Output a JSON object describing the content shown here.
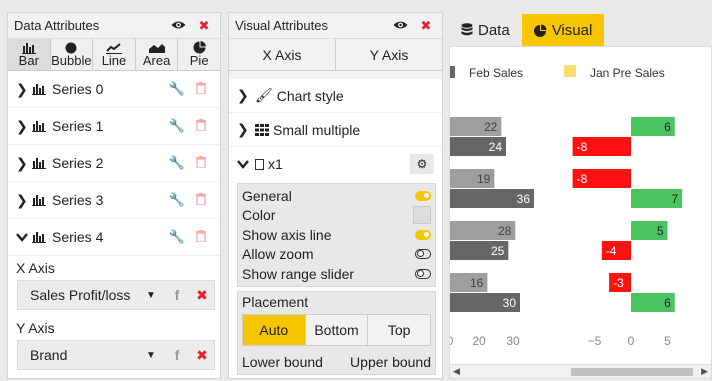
{
  "data_panel": {
    "title": "Data Attributes",
    "chart_types": [
      {
        "label": "Bar",
        "icon": "bar-chart-icon"
      },
      {
        "label": "Bubble",
        "icon": "bubble-icon"
      },
      {
        "label": "Line",
        "icon": "line-chart-icon"
      },
      {
        "label": "Area",
        "icon": "area-chart-icon"
      },
      {
        "label": "Pie",
        "icon": "pie-chart-icon"
      }
    ],
    "series": [
      {
        "label": "Series 0",
        "expanded": false
      },
      {
        "label": "Series 1",
        "expanded": false
      },
      {
        "label": "Series 2",
        "expanded": false
      },
      {
        "label": "Series 3",
        "expanded": false
      },
      {
        "label": "Series 4",
        "expanded": true
      }
    ],
    "x_axis_label": "X Axis",
    "x_axis_value": "Sales Profit/loss",
    "y_axis_label": "Y Axis",
    "y_axis_value": "Brand"
  },
  "visual_panel": {
    "title": "Visual Attributes",
    "tabs": [
      "X Axis",
      "Y Axis"
    ],
    "chart_style": "Chart style",
    "small_multiple": "Small multiple",
    "x1": "x1",
    "options": [
      {
        "label": "General",
        "type": "toggle",
        "on": true
      },
      {
        "label": "Color",
        "type": "swatch"
      },
      {
        "label": "Show axis line",
        "type": "toggle",
        "on": true
      },
      {
        "label": "Allow zoom",
        "type": "toggle",
        "on": false
      },
      {
        "label": "Show range slider",
        "type": "toggle",
        "on": false
      }
    ],
    "placement_label": "Placement",
    "placement_options": [
      "Auto",
      "Bottom",
      "Top"
    ],
    "placement_selected": "Auto",
    "lower_bound": "Lower bound",
    "upper_bound": "Upper bound"
  },
  "view_tabs": {
    "data": "Data",
    "visual": "Visual",
    "active": "Visual"
  },
  "colors": {
    "accent": "#f7c600",
    "delete": "#e8222a",
    "bar_gray_light": "#9e9e9e",
    "bar_gray_dark": "#666666",
    "bar_green": "#4cc462",
    "bar_red": "#ff1111",
    "legend_yellow": "#f7dc6f"
  },
  "chart_data": {
    "type": "bar",
    "orientation": "horizontal",
    "legend": [
      {
        "name": "Feb Sales",
        "color": "#666666"
      },
      {
        "name": "Jan Pre Sales",
        "color": "#f7dc6f"
      }
    ],
    "groups": [
      {
        "left": [
          22,
          24
        ],
        "right": [
          6,
          -8
        ]
      },
      {
        "left": [
          19,
          36
        ],
        "right": [
          -8,
          7
        ]
      },
      {
        "left": [
          28,
          25
        ],
        "right": [
          5,
          -4
        ]
      },
      {
        "left": [
          16,
          30
        ],
        "right": [
          -3,
          6
        ]
      }
    ],
    "left_axis": {
      "ticks": [
        "0",
        "20",
        "30"
      ]
    },
    "right_axis": {
      "ticks": [
        "−5",
        "0",
        "5"
      ],
      "range": [
        -8,
        8
      ]
    }
  }
}
